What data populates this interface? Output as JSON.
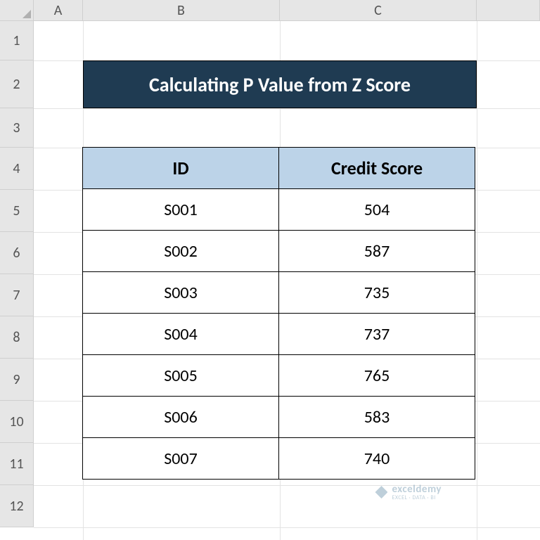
{
  "columns": {
    "A": "A",
    "B": "B",
    "C": "C",
    "D": ""
  },
  "rows": {
    "r1": "1",
    "r2": "2",
    "r3": "3",
    "r4": "4",
    "r5": "5",
    "r6": "6",
    "r7": "7",
    "r8": "8",
    "r9": "9",
    "r10": "10",
    "r11": "11",
    "r12": "12"
  },
  "title": "Calculating P Value from Z Score",
  "table": {
    "headers": {
      "id": "ID",
      "score": "Credit Score"
    },
    "rows": [
      {
        "id": "S001",
        "score": "504"
      },
      {
        "id": "S002",
        "score": "587"
      },
      {
        "id": "S003",
        "score": "735"
      },
      {
        "id": "S004",
        "score": "737"
      },
      {
        "id": "S005",
        "score": "765"
      },
      {
        "id": "S006",
        "score": "583"
      },
      {
        "id": "S007",
        "score": "740"
      }
    ]
  },
  "watermark": {
    "brand": "exceldemy",
    "sub": "EXCEL · DATA · BI"
  }
}
